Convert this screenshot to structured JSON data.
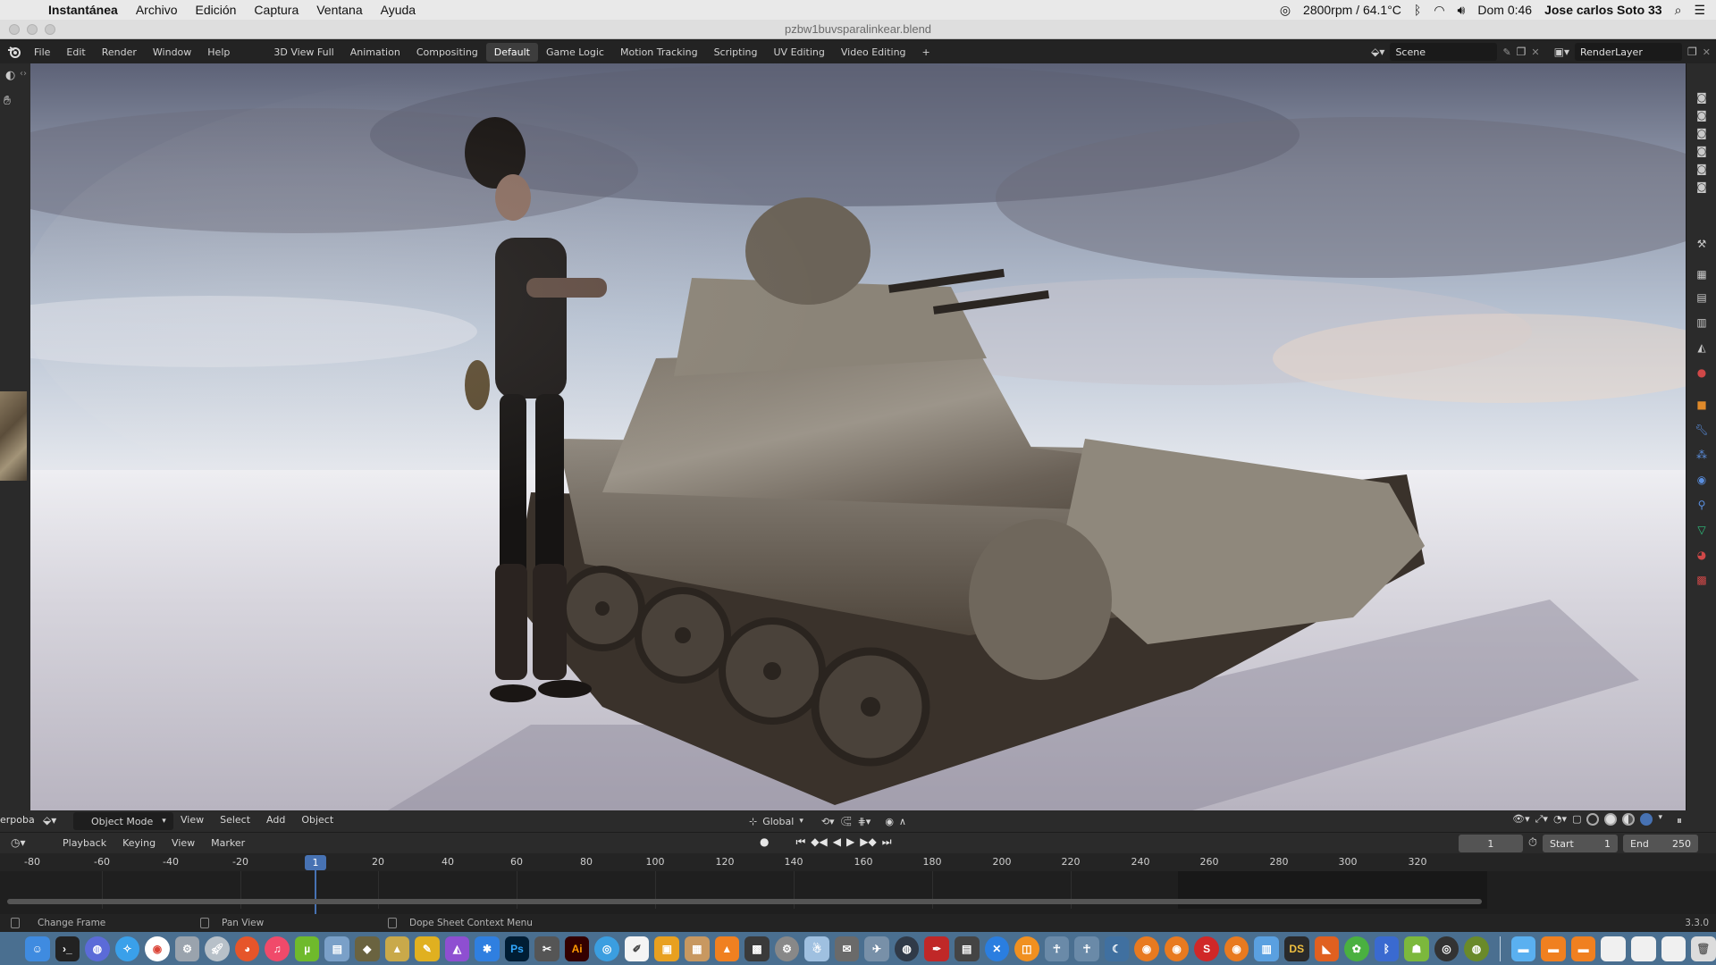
{
  "macbar": {
    "app": "Instantánea",
    "menus": [
      "Archivo",
      "Edición",
      "Captura",
      "Ventana",
      "Ayuda"
    ],
    "fan": "2800rpm / 64.1°C",
    "clock": "Dom 0:46",
    "user": "Jose carlos Soto 33"
  },
  "window": {
    "title": "pzbw1buvsparalinkear.blend"
  },
  "topbar": {
    "menus": [
      "File",
      "Edit",
      "Render",
      "Window",
      "Help"
    ],
    "workspaces": [
      "3D View Full",
      "Animation",
      "Compositing",
      "Default",
      "Game Logic",
      "Motion Tracking",
      "Scripting",
      "UV Editing",
      "Video Editing",
      "+"
    ],
    "active_workspace": "Default",
    "scene": "Scene",
    "view_layer": "RenderLayer"
  },
  "viewport_header": {
    "left_label": "erpoba",
    "mode": "Object Mode",
    "menus": [
      "View",
      "Select",
      "Add",
      "Object"
    ],
    "orientation": "Global"
  },
  "timeline_header": {
    "menus": [
      "Playback",
      "Keying",
      "View",
      "Marker"
    ],
    "current_frame": "1",
    "start_label": "Start",
    "start": "1",
    "end_label": "End",
    "end": "250"
  },
  "timeline": {
    "ticks": [
      "-80",
      "-60",
      "-40",
      "-20",
      "20",
      "40",
      "60",
      "80",
      "100",
      "120",
      "140",
      "160",
      "180",
      "200",
      "220",
      "240",
      "260",
      "280",
      "300",
      "320"
    ],
    "playhead": "1"
  },
  "statusbar": {
    "change_frame": "Change Frame",
    "pan_view": "Pan View",
    "context_menu": "Dope Sheet Context Menu",
    "version": "3.3.0"
  },
  "dock": {
    "photoshop": "Ps",
    "illustrator": "Ai",
    "daz": "DS"
  }
}
